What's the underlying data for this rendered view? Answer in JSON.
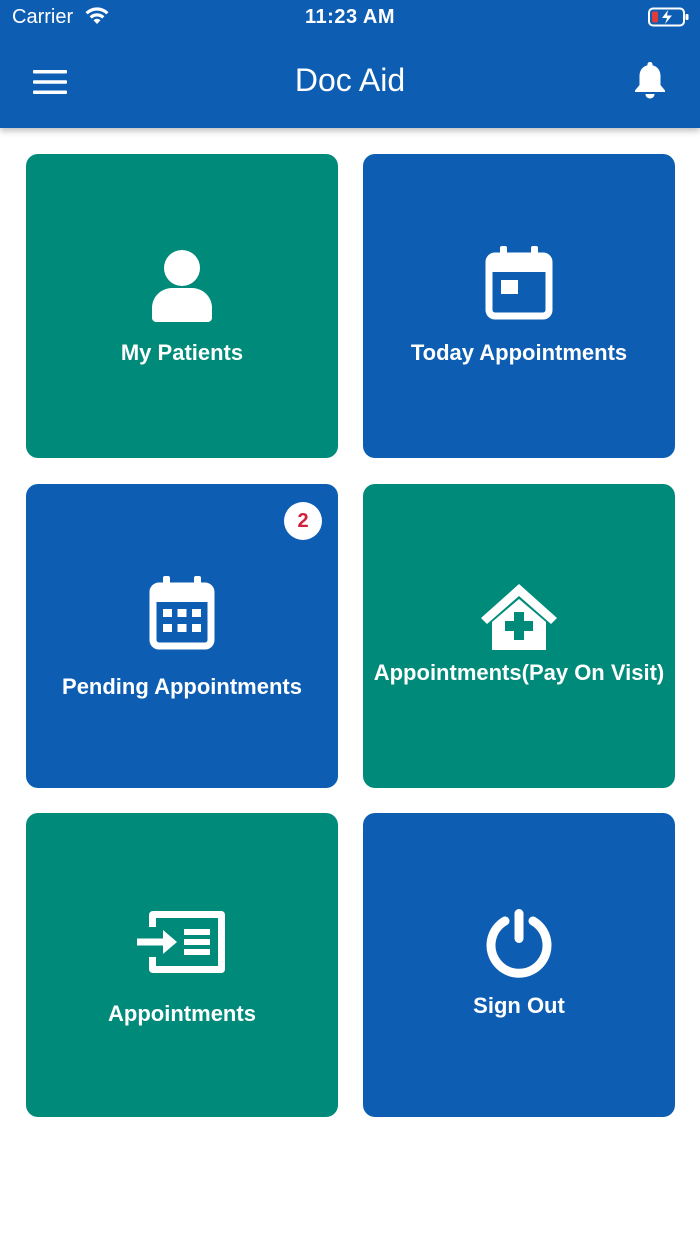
{
  "status_bar": {
    "carrier": "Carrier",
    "time": "11:23 AM"
  },
  "header": {
    "title": "Doc Aid",
    "menu_icon": "hamburger-menu-icon",
    "notification_icon": "bell-icon"
  },
  "colors": {
    "primary_blue": "#0d5eb2",
    "teal": "#008a7a",
    "badge_text": "#d0213b"
  },
  "tiles": [
    {
      "label": "My Patients",
      "icon": "user-icon",
      "color": "teal"
    },
    {
      "label": "Today Appointments",
      "icon": "calendar-icon",
      "color": "blue"
    },
    {
      "label": "Pending Appointments",
      "icon": "calendar-grid-icon",
      "color": "blue",
      "badge": "2"
    },
    {
      "label": "Appointments(Pay On Visit)",
      "icon": "clinic-house-icon",
      "color": "teal"
    },
    {
      "label": "Appointments",
      "icon": "sign-in-list-icon",
      "color": "teal"
    },
    {
      "label": "Sign Out",
      "icon": "power-icon",
      "color": "blue"
    }
  ]
}
